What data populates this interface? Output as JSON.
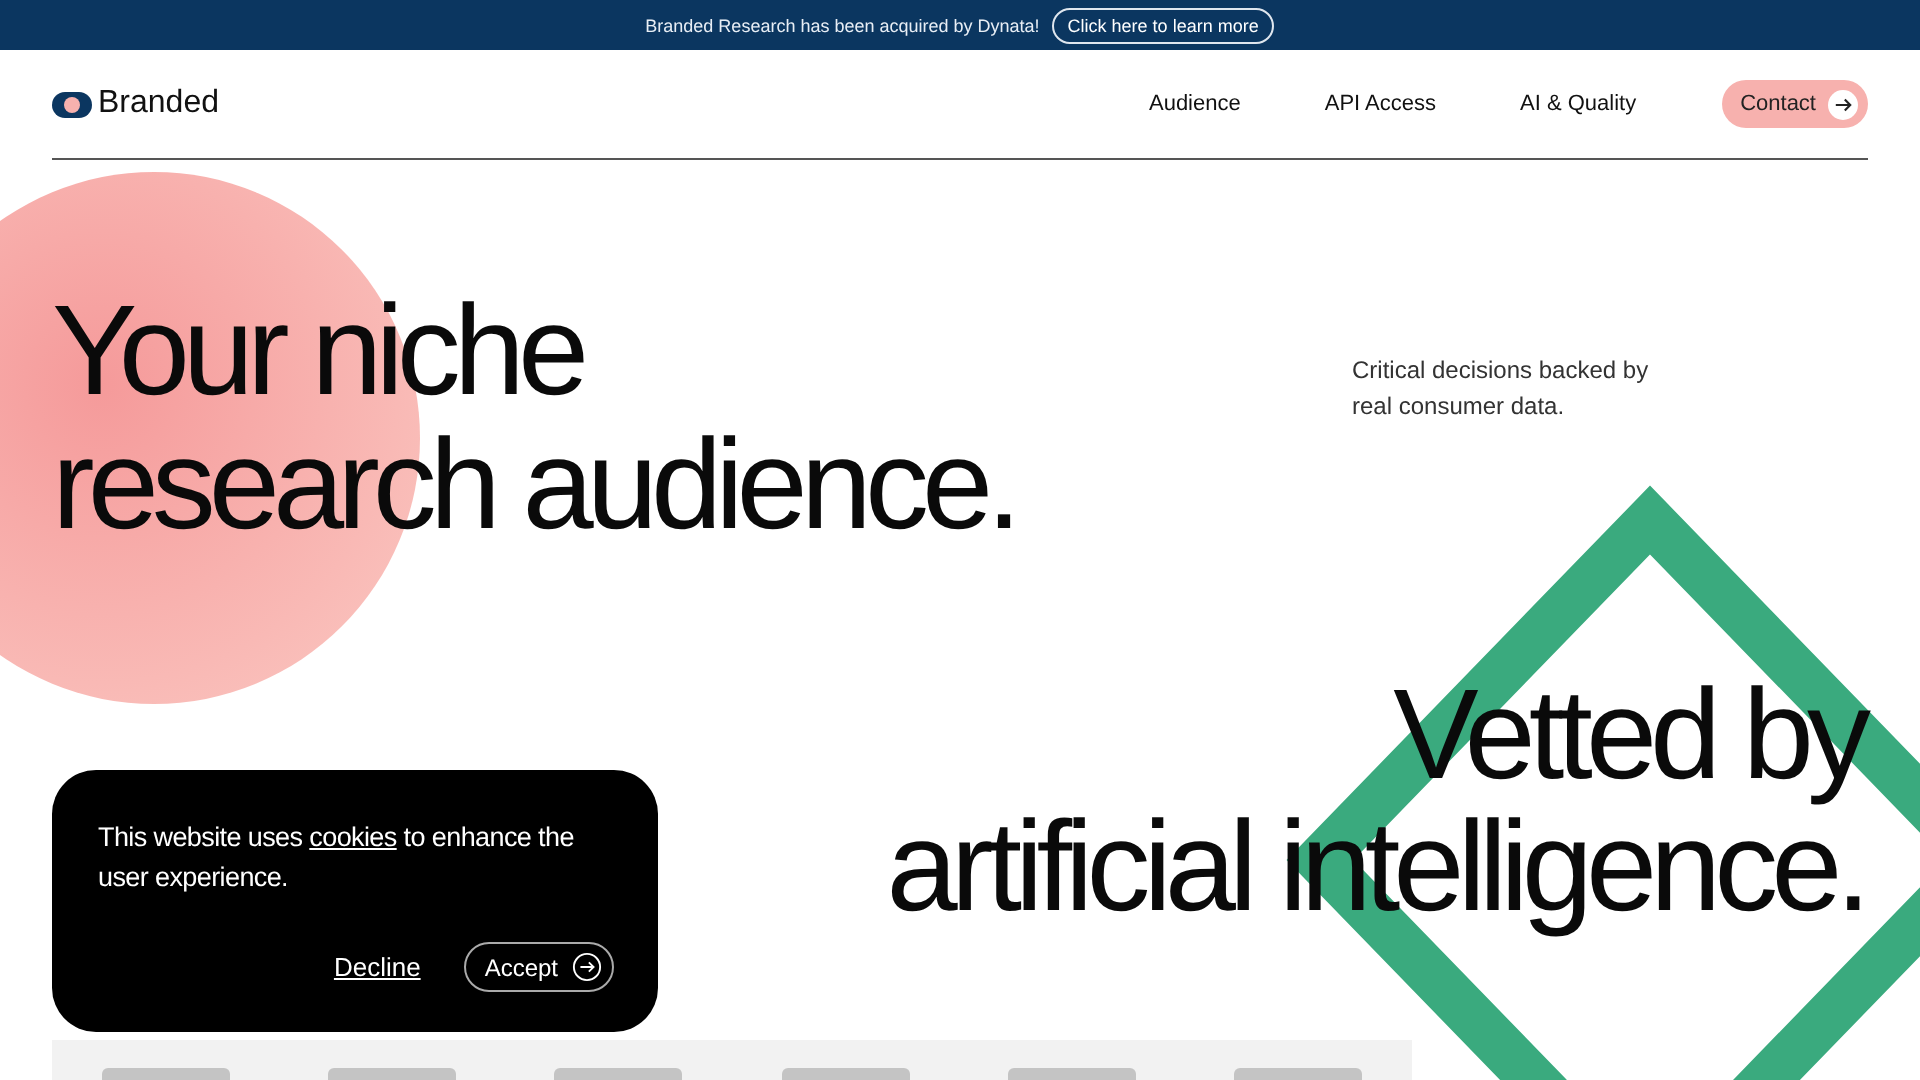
{
  "announcement": {
    "text": "Branded Research has been acquired by Dynata!",
    "link": "Click here to learn more"
  },
  "header": {
    "logo": "Branded",
    "nav": [
      "Audience",
      "API Access",
      "AI & Quality"
    ],
    "contact": "Contact"
  },
  "hero": {
    "title_lines": [
      "Your niche",
      "research audience."
    ],
    "tagline": "Critical decisions backed by real consumer data.",
    "subtitle_lines": [
      "Vetted by",
      "artificial intelligence."
    ]
  },
  "cookie_banner": {
    "text_before": "This website uses ",
    "link": "cookies",
    "text_after": " to enhance the user experience.",
    "decline": "Decline",
    "accept": "Accept"
  }
}
